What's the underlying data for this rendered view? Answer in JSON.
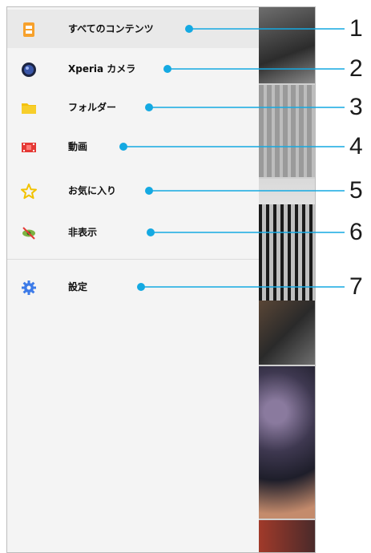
{
  "menu": {
    "items": [
      {
        "label": "すべてのコンテンツ",
        "icon": "all-content-icon",
        "color": "#f7a12c"
      },
      {
        "label": "Xperia カメラ",
        "icon": "camera-lens-icon",
        "color": "#2f3b6b"
      },
      {
        "label": "フォルダー",
        "icon": "folder-icon",
        "color": "#f4c20d"
      },
      {
        "label": "動画",
        "icon": "video-film-icon",
        "color": "#e53935"
      },
      {
        "label": "お気に入り",
        "icon": "star-icon",
        "color": "#f2c200"
      },
      {
        "label": "非表示",
        "icon": "hidden-eye-icon",
        "color": "#7cb342"
      },
      {
        "label": "設定",
        "icon": "gear-icon",
        "color": "#3d7be8"
      }
    ]
  },
  "callouts": [
    "1",
    "2",
    "3",
    "4",
    "5",
    "6",
    "7"
  ],
  "colors": {
    "callout_line": "#14a9e2",
    "active_row": "#e9e9e9"
  }
}
